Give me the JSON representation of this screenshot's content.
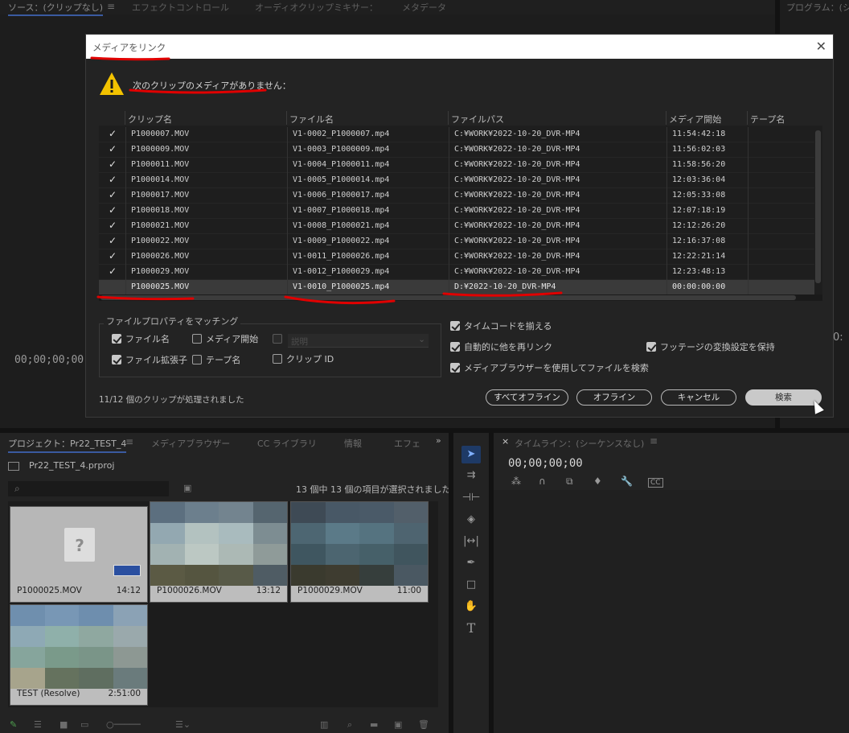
{
  "top_panel": {
    "tabs": [
      "ソース：(クリップなし)",
      "エフェクトコントロール",
      "オーディオクリップミキサー：",
      "メタデータ"
    ],
    "menu_icon": "≡",
    "program_tab": "プログラム：(シ",
    "source_timecode": "00;00;00;00",
    "program_timecode": "0:"
  },
  "dialog": {
    "title": "メディアをリンク",
    "warning": "次のクリップのメディアがありません：",
    "columns": [
      "クリップ名",
      "ファイル名",
      "ファイルパス",
      "メディア開始",
      "テープ名"
    ],
    "rows": [
      {
        "checked": true,
        "clip": "P1000007.MOV",
        "file": "V1-0002_P1000007.mp4",
        "path": "C:¥WORK¥2022-10-20_DVR-MP4",
        "start": "11:54:42:18",
        "tape": ""
      },
      {
        "checked": true,
        "clip": "P1000009.MOV",
        "file": "V1-0003_P1000009.mp4",
        "path": "C:¥WORK¥2022-10-20_DVR-MP4",
        "start": "11:56:02:03",
        "tape": ""
      },
      {
        "checked": true,
        "clip": "P1000011.MOV",
        "file": "V1-0004_P1000011.mp4",
        "path": "C:¥WORK¥2022-10-20_DVR-MP4",
        "start": "11:58:56:20",
        "tape": ""
      },
      {
        "checked": true,
        "clip": "P1000014.MOV",
        "file": "V1-0005_P1000014.mp4",
        "path": "C:¥WORK¥2022-10-20_DVR-MP4",
        "start": "12:03:36:04",
        "tape": ""
      },
      {
        "checked": true,
        "clip": "P1000017.MOV",
        "file": "V1-0006_P1000017.mp4",
        "path": "C:¥WORK¥2022-10-20_DVR-MP4",
        "start": "12:05:33:08",
        "tape": ""
      },
      {
        "checked": true,
        "clip": "P1000018.MOV",
        "file": "V1-0007_P1000018.mp4",
        "path": "C:¥WORK¥2022-10-20_DVR-MP4",
        "start": "12:07:18:19",
        "tape": ""
      },
      {
        "checked": true,
        "clip": "P1000021.MOV",
        "file": "V1-0008_P1000021.mp4",
        "path": "C:¥WORK¥2022-10-20_DVR-MP4",
        "start": "12:12:26:20",
        "tape": ""
      },
      {
        "checked": true,
        "clip": "P1000022.MOV",
        "file": "V1-0009_P1000022.mp4",
        "path": "C:¥WORK¥2022-10-20_DVR-MP4",
        "start": "12:16:37:08",
        "tape": ""
      },
      {
        "checked": true,
        "clip": "P1000026.MOV",
        "file": "V1-0011_P1000026.mp4",
        "path": "C:¥WORK¥2022-10-20_DVR-MP4",
        "start": "12:22:21:14",
        "tape": ""
      },
      {
        "checked": true,
        "clip": "P1000029.MOV",
        "file": "V1-0012_P1000029.mp4",
        "path": "C:¥WORK¥2022-10-20_DVR-MP4",
        "start": "12:23:48:13",
        "tape": ""
      },
      {
        "checked": false,
        "clip": "P1000025.MOV",
        "file": "V1-0010_P1000025.mp4",
        "path": "D:¥2022-10-20_DVR-MP4",
        "start": "00:00:00:00",
        "tape": "",
        "selected": true
      }
    ],
    "match_group_title": "ファイルプロパティをマッチング",
    "match_options": {
      "filename": {
        "label": "ファイル名",
        "checked": true
      },
      "media_start": {
        "label": "メディア開始",
        "checked": false
      },
      "description": {
        "label": "説明",
        "checked": false,
        "disabled": true
      },
      "extension": {
        "label": "ファイル拡張子",
        "checked": true
      },
      "tape_name": {
        "label": "テープ名",
        "checked": false
      },
      "clip_id": {
        "label": "クリップ ID",
        "checked": false
      }
    },
    "options": {
      "align_timecode": {
        "label": "タイムコードを揃える",
        "checked": true
      },
      "relink_others": {
        "label": "自動的に他を再リンク",
        "checked": true
      },
      "preserve_interpret": {
        "label": "フッテージの変換設定を保持",
        "checked": true
      },
      "media_browser": {
        "label": "メディアブラウザーを使用してファイルを検索",
        "checked": true
      }
    },
    "status": "11/12 個のクリップが処理されました",
    "buttons": {
      "offline_all": "すべてオフライン",
      "offline": "オフライン",
      "cancel": "キャンセル",
      "search": "検索"
    }
  },
  "project": {
    "tabs": [
      "プロジェクト：Pr22_TEST_4",
      "メディアブラウザー",
      "CC ライブラリ",
      "情報",
      "エフェ"
    ],
    "overflow": "»",
    "file": "Pr22_TEST_4.prproj",
    "selection_count": "13 個中 13 個の項目が選択されました",
    "items": [
      {
        "name": "P1000025.MOV",
        "duration": "14:12",
        "missing": true
      },
      {
        "name": "P1000026.MOV",
        "duration": "13:12"
      },
      {
        "name": "P1000029.MOV",
        "duration": "11:00"
      },
      {
        "name": "TEST (Resolve)",
        "duration": "2:51:00"
      }
    ]
  },
  "timeline": {
    "tab": "タイムライン：(シーケンスなし)",
    "timecode": "00;00;00;00",
    "close": "×",
    "icon_labels": [
      "CC"
    ]
  },
  "colors": {
    "annotation_red": "#e00000",
    "selection_blue": "#3a5aa0",
    "warning_yellow": "#f2c200"
  },
  "icons": [
    "warning-icon",
    "checkmark-icon",
    "close-icon",
    "search-icon",
    "question-file-icon",
    "selection-tool-icon",
    "hand-tool-icon",
    "type-tool-icon",
    "pen-tool-icon",
    "razor-tool-icon",
    "wrench-icon",
    "magnet-icon",
    "marker-icon"
  ]
}
